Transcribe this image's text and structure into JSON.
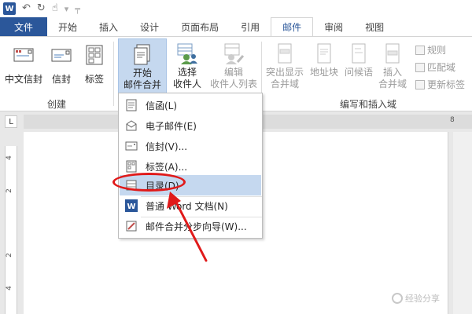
{
  "titlebar": {
    "app_icon": "W",
    "undo_icon": "↶",
    "redo_icon": "↻",
    "touch_icon": "☝",
    "more_icon": "▾",
    "customize_icon": "╤"
  },
  "tabs": [
    {
      "label": "文件"
    },
    {
      "label": "开始"
    },
    {
      "label": "插入"
    },
    {
      "label": "设计"
    },
    {
      "label": "页面布局"
    },
    {
      "label": "引用"
    },
    {
      "label": "邮件"
    },
    {
      "label": "审阅"
    },
    {
      "label": "视图"
    }
  ],
  "ribbon": {
    "create_group": {
      "label": "创建",
      "buttons": [
        {
          "label": "中文信封"
        },
        {
          "label": "信封"
        },
        {
          "label": "标签"
        }
      ]
    },
    "start_merge": {
      "line1": "开始",
      "line2": "邮件合并"
    },
    "select_recipients": {
      "line1": "选择",
      "line2": "收件人"
    },
    "edit_recipients": {
      "line1": "编辑",
      "line2": "收件人列表"
    },
    "write_insert_group": {
      "label": "编写和插入域",
      "buttons": [
        {
          "line1": "突出显示",
          "line2": "合并域"
        },
        {
          "line1": "地址块",
          "line2": ""
        },
        {
          "line1": "问候语",
          "line2": ""
        },
        {
          "line1": "插入",
          "line2": "合并域"
        }
      ],
      "small_buttons": [
        {
          "label": "规则"
        },
        {
          "label": "匹配域"
        },
        {
          "label": "更新标签"
        }
      ]
    }
  },
  "ruler": {
    "corner_label": "L",
    "h_number": "8",
    "v_numbers": [
      "4",
      "2",
      "2",
      "4"
    ]
  },
  "menu": {
    "items": [
      {
        "label": "信函(L)"
      },
      {
        "label": "电子邮件(E)"
      },
      {
        "label": "信封(V)..."
      },
      {
        "label": "标签(A)..."
      },
      {
        "label": "目录(D)"
      },
      {
        "label": "普通 Word 文档(N)"
      },
      {
        "label": "邮件合并分步向导(W)..."
      }
    ]
  },
  "watermark": {
    "text": "经验分享"
  },
  "colors": {
    "accent": "#2b579a",
    "annotation": "#e01a1a",
    "highlight": "#c5d8ef"
  }
}
